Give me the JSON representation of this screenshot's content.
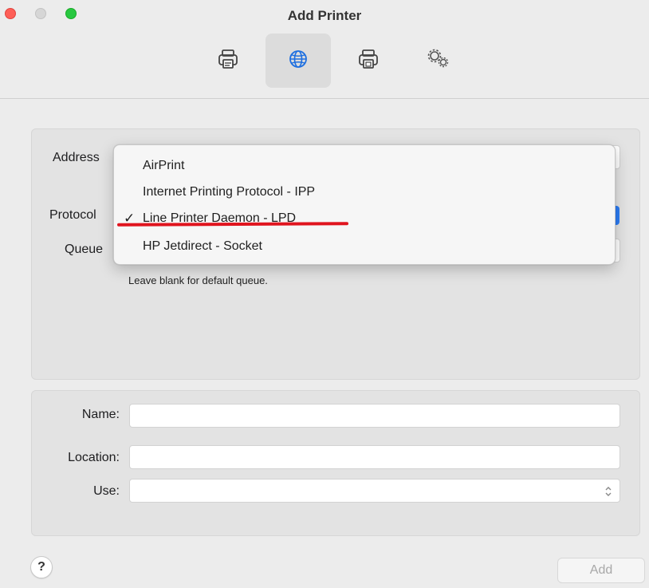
{
  "window": {
    "title": "Add Printer"
  },
  "toolbar": {
    "items": [
      {
        "icon": "printer-icon",
        "selected": false
      },
      {
        "icon": "globe-icon",
        "selected": true
      },
      {
        "icon": "printer-alt-icon",
        "selected": false
      },
      {
        "icon": "gears-icon",
        "selected": false
      }
    ]
  },
  "form_top": {
    "address_label": "Address",
    "protocol_label": "Protocol",
    "queue_label": "Queue",
    "queue_hint": "Leave blank for default queue."
  },
  "protocol_menu": {
    "options": [
      "AirPrint",
      "Internet Printing Protocol - IPP",
      "Line Printer Daemon - LPD",
      "HP Jetdirect - Socket"
    ],
    "selected": "Line Printer Daemon - LPD",
    "check_glyph": "✓"
  },
  "form_bottom": {
    "name_label": "Name:",
    "location_label": "Location:",
    "use_label": "Use:",
    "name_value": "",
    "location_value": "",
    "use_value": ""
  },
  "footer": {
    "help_label": "?",
    "add_label": "Add"
  },
  "colors": {
    "annotation_underline": "#e0141e",
    "accent": "#2c7df6"
  }
}
